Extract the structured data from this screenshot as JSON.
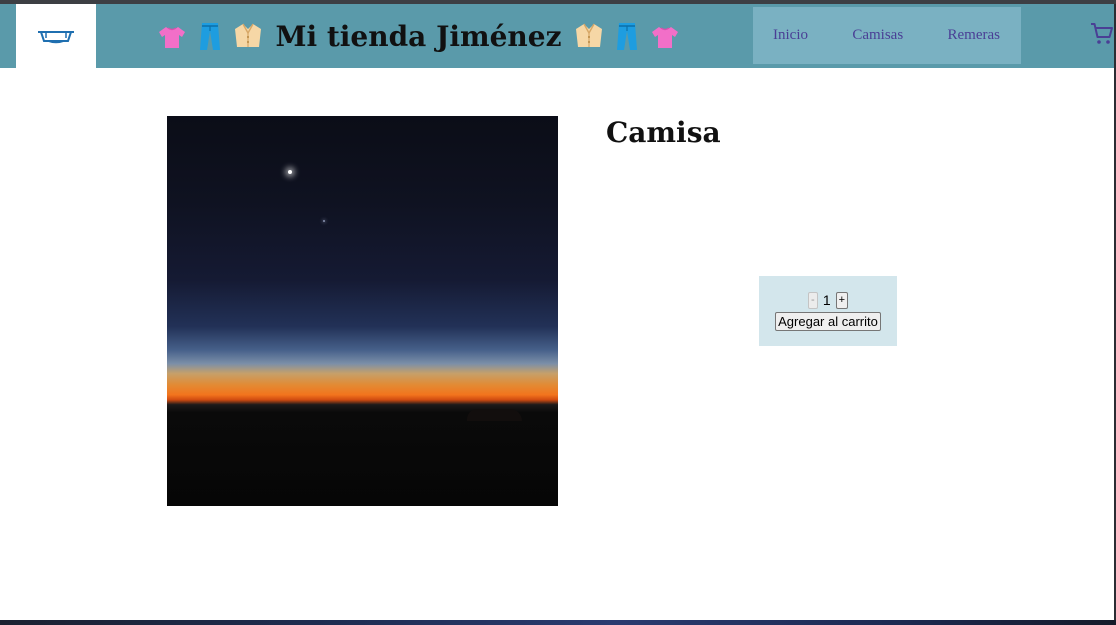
{
  "header": {
    "title": "Mi tienda Jiménez",
    "logo_icon": "boat-logo-icon",
    "title_emojis_left": [
      "tshirt-emoji-icon",
      "jeans-emoji-icon",
      "coat-emoji-icon"
    ],
    "title_emojis_right": [
      "coat-emoji-icon",
      "jeans-emoji-icon",
      "tshirt-emoji-icon"
    ]
  },
  "nav": {
    "items": [
      {
        "label": "Inicio"
      },
      {
        "label": "Camisas"
      },
      {
        "label": "Remeras"
      }
    ],
    "cart_icon": "shopping-cart-icon"
  },
  "product": {
    "title": "Camisa",
    "image": "night-sky-sunset-photo"
  },
  "cart_controls": {
    "decrement_label": "-",
    "quantity": "1",
    "increment_label": "+",
    "add_label": "Agregar al carrito"
  },
  "colors": {
    "header_bg": "#5a9aaa",
    "nav_bg": "#7ab1c2",
    "nav_link": "#4a3f95",
    "cart_box_bg": "#d3e6ec"
  }
}
